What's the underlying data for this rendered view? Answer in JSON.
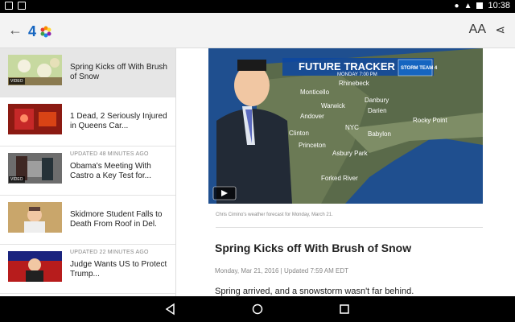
{
  "status": {
    "time": "10:38"
  },
  "appbar": {
    "back_icon": "arrow-left-icon",
    "logo_text": "4",
    "text_size_label": "AA",
    "share_icon": "share-icon"
  },
  "sidebar": {
    "items": [
      {
        "updated": "",
        "headline": "Spring Kicks off With Brush of Snow",
        "has_video": true,
        "video_label": "VIDEO"
      },
      {
        "updated": "",
        "headline": "1 Dead, 2 Seriously Injured in Queens Car...",
        "has_video": false,
        "video_label": ""
      },
      {
        "updated": "UPDATED 48 MINUTES AGO",
        "headline": "Obama's Meeting With Castro a Key Test for...",
        "has_video": true,
        "video_label": "VIDEO"
      },
      {
        "updated": "",
        "headline": "Skidmore Student Falls to Death From Roof in Del.",
        "has_video": false,
        "video_label": ""
      },
      {
        "updated": "UPDATED 22 MINUTES AGO",
        "headline": "Judge Wants US to Protect Trump...",
        "has_video": false,
        "video_label": ""
      }
    ]
  },
  "article": {
    "video": {
      "tracker_title": "FUTURE TRACKER",
      "tracker_time": "MONDAY 7:00 PM",
      "storm_badge": "STORM TEAM 4",
      "map_labels": [
        "Rhinebeck",
        "Monticello",
        "Warwick",
        "Danbury",
        "Andover",
        "Darien",
        "Rocky Point",
        "NYC",
        "Babylon",
        "Clinton",
        "Princeton",
        "Asbury Park",
        "Forked River"
      ]
    },
    "caption": "Chris Cimino's weather forecast for Monday, March 21.",
    "title": "Spring Kicks off With Brush of Snow",
    "meta": "Monday, Mar 21, 2016 | Updated 7:59 AM EDT",
    "body": "Spring arrived, and a snowstorm wasn't far behind."
  },
  "colors": {
    "statusbar": "#000000",
    "appbar": "#f3f3f3",
    "accent": "#1565c0",
    "active_item": "#e6e6e6"
  }
}
